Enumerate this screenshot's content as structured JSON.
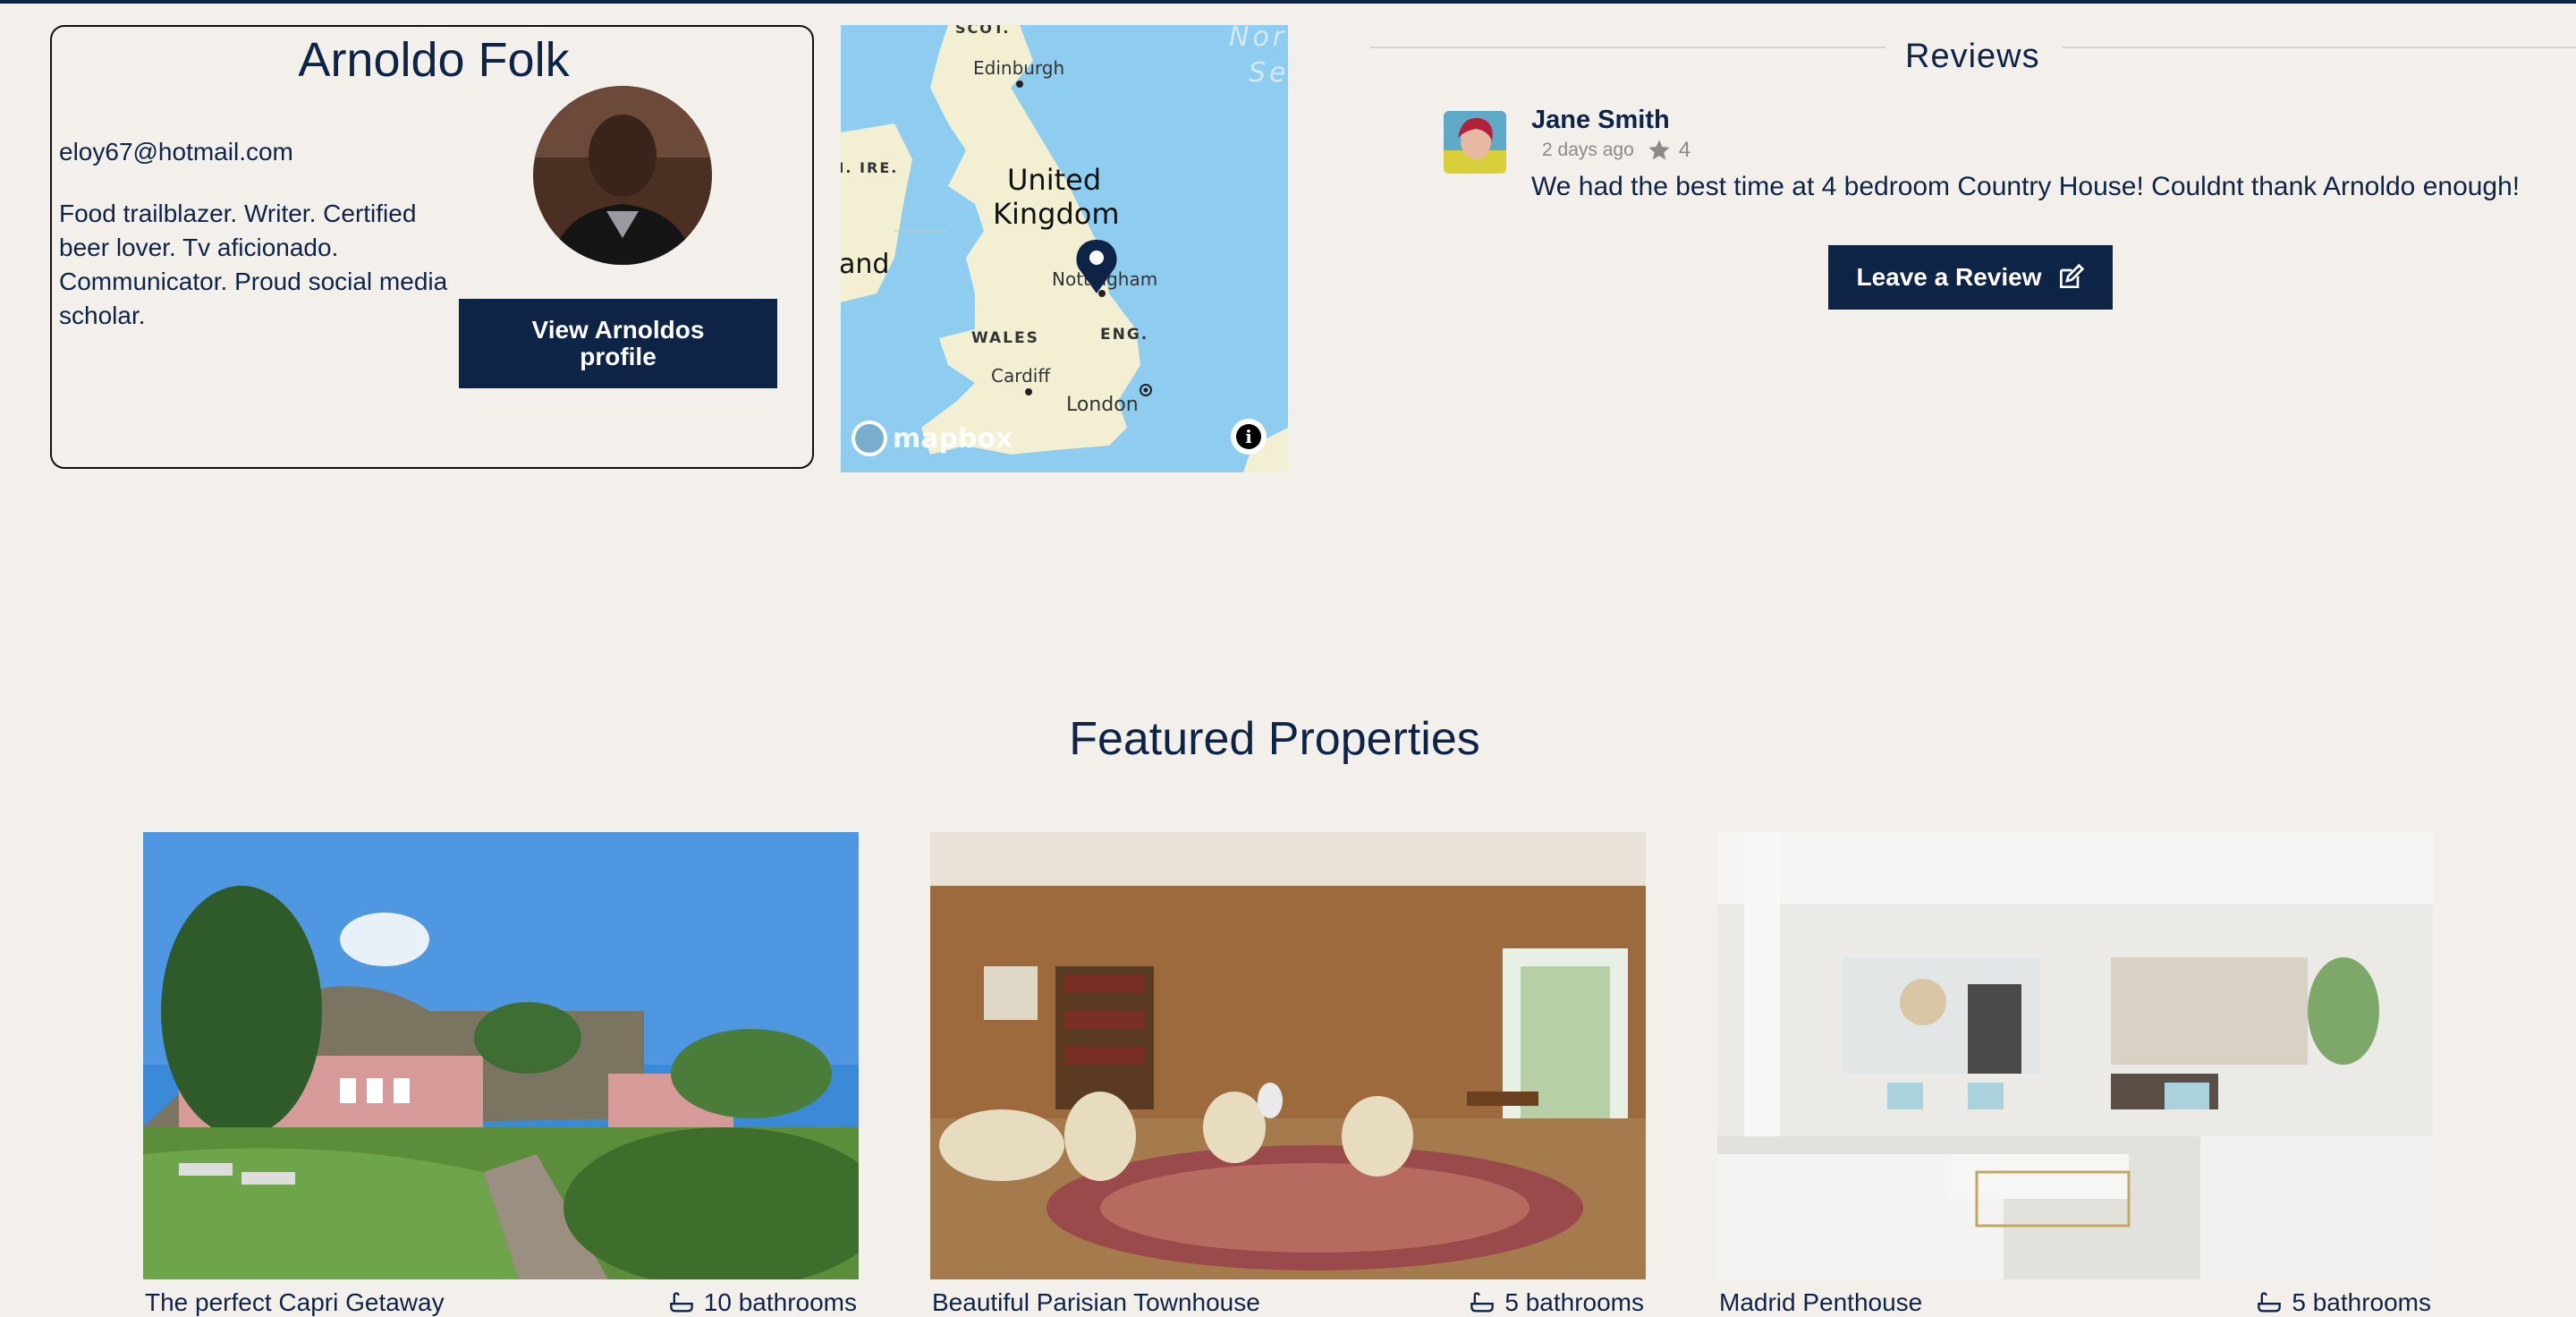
{
  "host": {
    "name": "Arnoldo Folk",
    "email": "eloy67@hotmail.com",
    "bio": "Food trailblazer. Writer. Certified beer lover. Tv aficionado. Communicator. Proud social media scholar.",
    "profile_button": "View Arnoldos profile"
  },
  "map": {
    "labels": {
      "scot": "SCOT.",
      "edinburgh": "Edinburgh",
      "north_sea": "Nor",
      "north_sea2": "Se",
      "ire": "N. IRE.",
      "uk": "United",
      "uk2": "Kingdom",
      "ireland": "and",
      "nottingham": "Nottingham",
      "wales": "WALES",
      "eng": "ENG.",
      "cardiff": "Cardiff",
      "london": "London"
    },
    "brand": "mapbox"
  },
  "reviews": {
    "title": "Reviews",
    "items": [
      {
        "name": "Jane Smith",
        "time": "2 days ago",
        "rating": "4",
        "text": "We had the best time at 4 bedroom Country House! Couldnt thank Arnoldo enough!"
      }
    ],
    "leave_button": "Leave a Review"
  },
  "featured": {
    "title": "Featured Properties",
    "properties": [
      {
        "name": "The perfect Capri Getaway",
        "baths": "10 bathrooms"
      },
      {
        "name": "Beautiful Parisian Townhouse",
        "baths": "5 bathrooms"
      },
      {
        "name": "Madrid Penthouse",
        "baths": "5 bathrooms"
      }
    ]
  },
  "colors": {
    "navy": "#0e2447",
    "background": "#f3f0ec",
    "sea": "#8ecdf0",
    "land": "#f2efd2"
  }
}
